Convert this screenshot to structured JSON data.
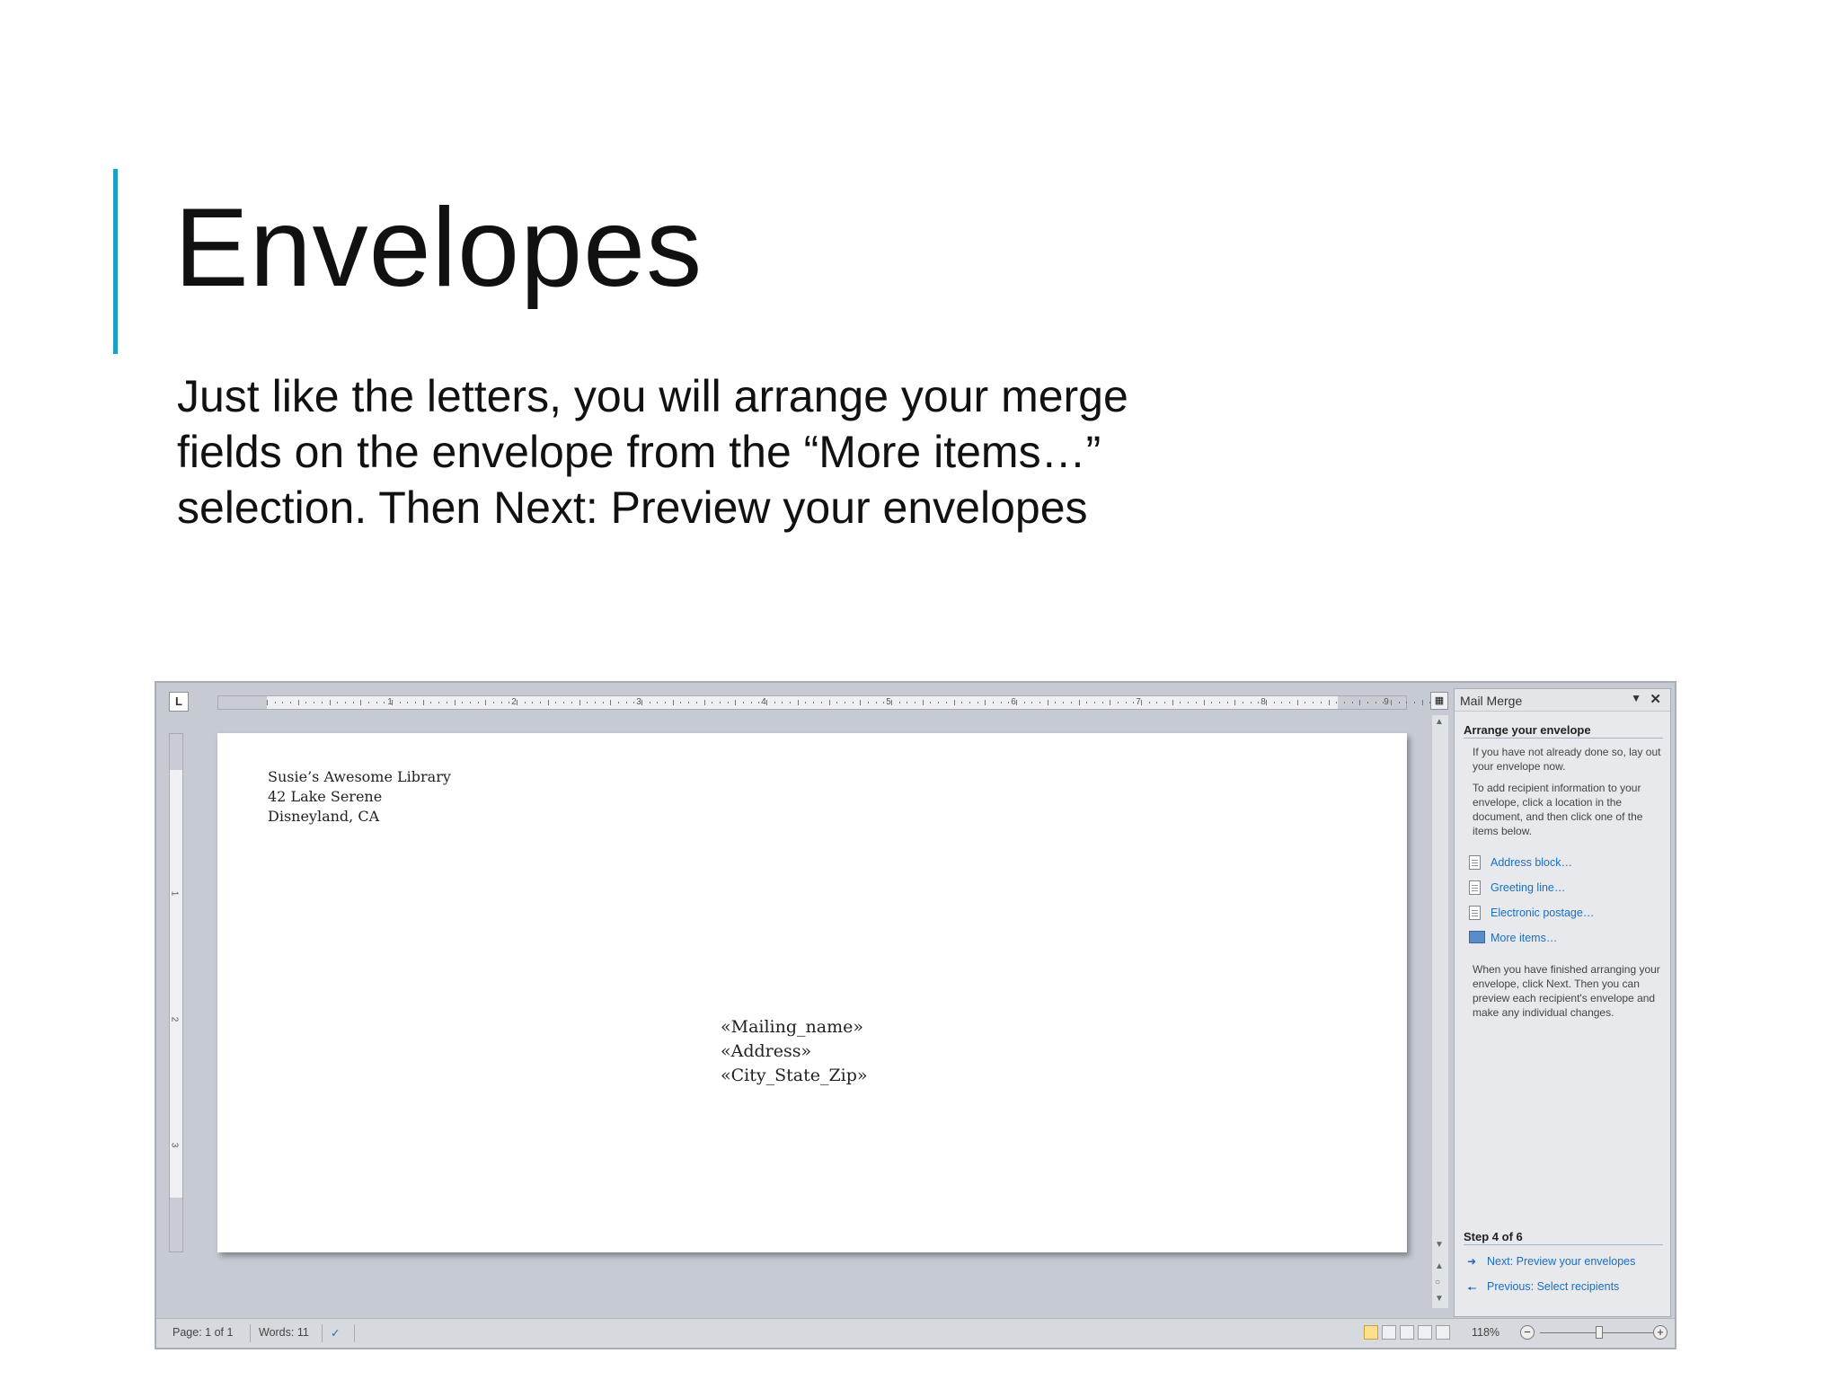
{
  "slide": {
    "title": "Envelopes",
    "body": "Just like the letters, you will arrange your merge fields on the envelope from the “More items…” selection. Then Next: Preview your envelopes",
    "accent_color": "#1ba1c8"
  },
  "ruler": {
    "corner_label": "L",
    "h_numbers": [
      "1",
      "2",
      "3",
      "4",
      "5",
      "6",
      "7",
      "8",
      "9"
    ],
    "v_numbers": [
      "1",
      "2",
      "3"
    ]
  },
  "envelope": {
    "return_address": [
      "Susie’s Awesome Library",
      "42 Lake Serene",
      "Disneyland, CA"
    ],
    "recipient_fields": [
      "«Mailing_name»",
      "«Address»",
      "«City_State_Zip»"
    ]
  },
  "pane": {
    "title": "Mail Merge",
    "section_title": "Arrange your envelope",
    "intro_text": "If you have not already done so, lay out your envelope now.",
    "instructions_text": "To add recipient information to your envelope, click a location in the document, and then click one of the items below.",
    "links": [
      {
        "label": "Address block…",
        "icon": "document-icon"
      },
      {
        "label": "Greeting line…",
        "icon": "document-icon"
      },
      {
        "label": "Electronic postage…",
        "icon": "postage-icon"
      },
      {
        "label": "More items…",
        "icon": "more-items-icon"
      }
    ],
    "finish_text": "When you have finished arranging your envelope, click Next. Then you can preview each recipient's envelope and make any individual changes.",
    "step_label": "Step 4 of 6",
    "next_label": "Next: Preview your envelopes",
    "previous_label": "Previous: Select recipients",
    "link_color": "#1b6ec2"
  },
  "status_bar": {
    "page": "Page: 1 of 1",
    "words": "Words: 11",
    "zoom": "118%"
  }
}
